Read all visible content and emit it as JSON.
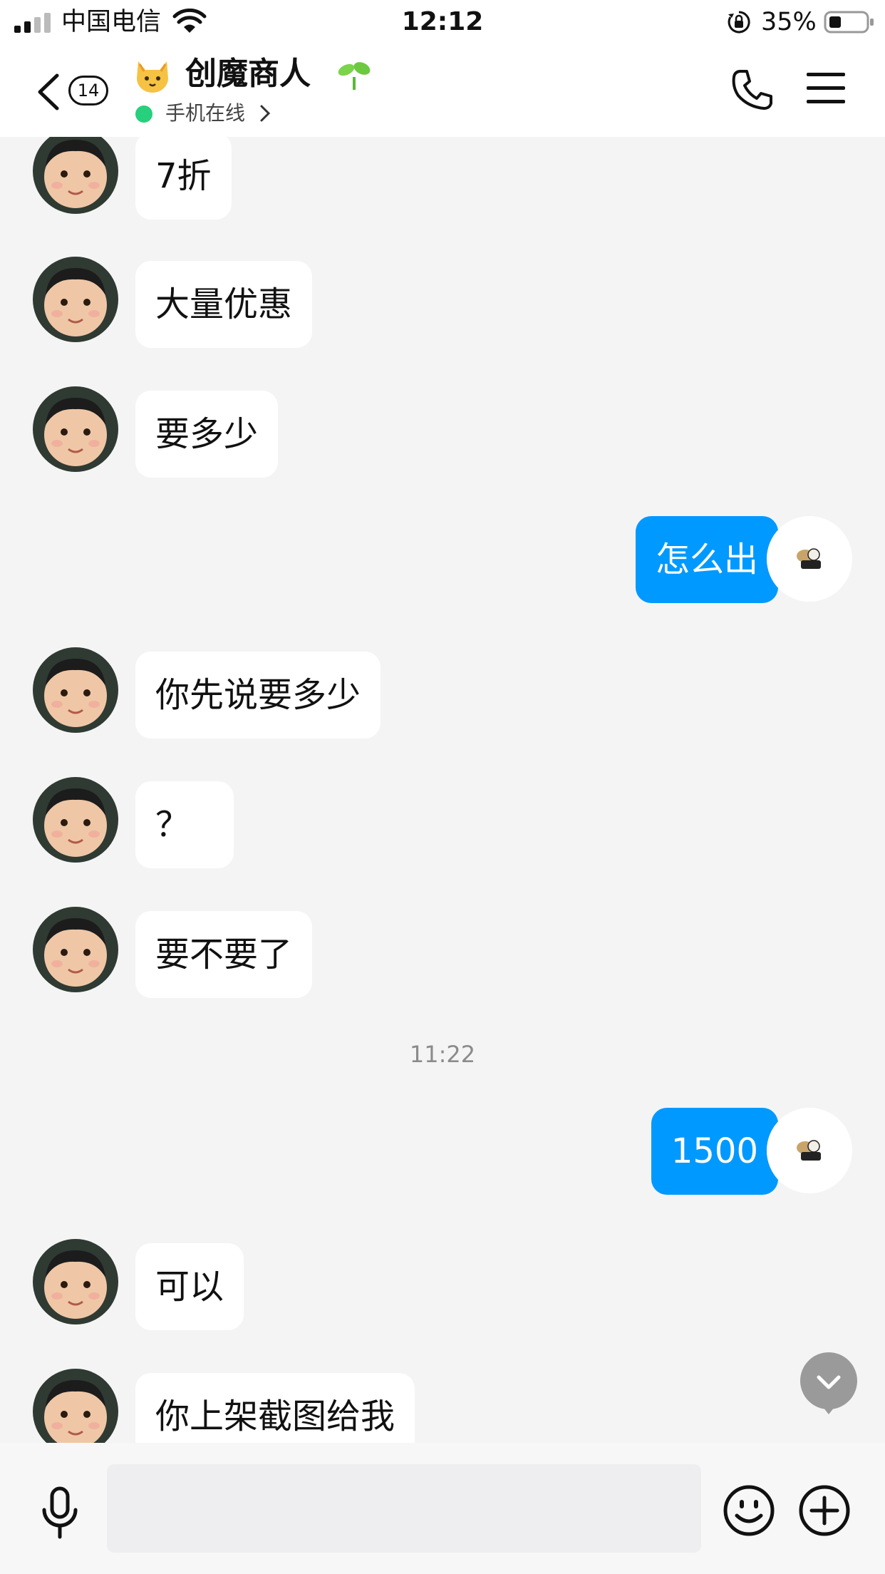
{
  "status_bar": {
    "carrier": "中国电信",
    "time": "12:12",
    "battery": "35%",
    "icons": [
      "signal-icon",
      "wifi-icon",
      "orientation-lock-icon",
      "battery-icon"
    ]
  },
  "header": {
    "unread_count": "14",
    "contact_name": "创魔商人",
    "status": "手机在线",
    "icons": [
      "back-chevron-icon",
      "cat-emoji-icon",
      "sprout-emoji-icon",
      "phone-icon",
      "menu-icon"
    ]
  },
  "messages": [
    {
      "from": "them",
      "text": "7折"
    },
    {
      "from": "them",
      "text": "大量优惠"
    },
    {
      "from": "them",
      "text": "要多少"
    },
    {
      "from": "me",
      "text": "怎么出"
    },
    {
      "from": "them",
      "text": "你先说要多少"
    },
    {
      "from": "them",
      "text": "？"
    },
    {
      "from": "them",
      "text": "要不要了"
    },
    {
      "type": "time",
      "text": "11:22"
    },
    {
      "from": "me",
      "text": "1500"
    },
    {
      "from": "them",
      "text": "可以"
    },
    {
      "from": "them",
      "text": "你上架截图给我"
    }
  ],
  "input": {
    "placeholder": "",
    "value": ""
  },
  "colors": {
    "outgoing_bubble": "#0099ff",
    "incoming_bubble": "#ffffff",
    "online": "#26d07c",
    "background": "#f4f4f5"
  }
}
